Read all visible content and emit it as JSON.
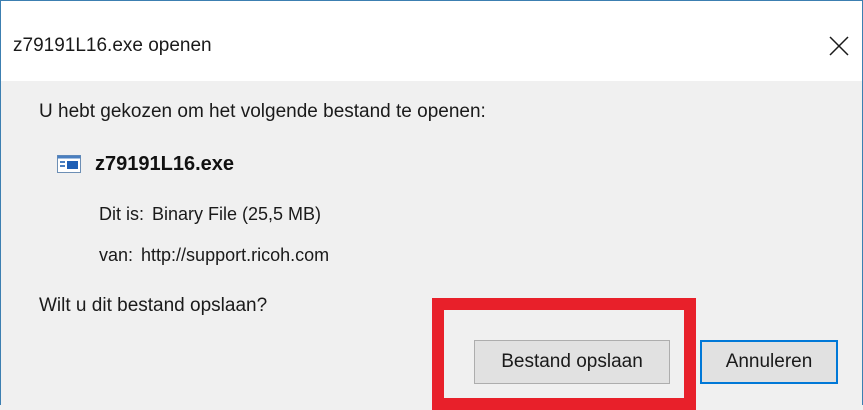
{
  "window": {
    "title": "z79191L16.exe openen"
  },
  "dialog": {
    "prompt": "U hebt gekozen om het volgende bestand te openen:",
    "file_name": "z79191L16.exe",
    "type_label": "Dit is:",
    "type_value": "Binary File (25,5 MB)",
    "from_label": "van:",
    "from_value": "http://support.ricoh.com",
    "question": "Wilt u dit bestand opslaan?"
  },
  "buttons": {
    "save_label": "Bestand opslaan",
    "cancel_label": "Annuleren"
  },
  "icons": {
    "close": "close-icon",
    "file": "application-file-icon"
  },
  "colors": {
    "highlight": "#e8202a",
    "accent": "#0078d7"
  }
}
